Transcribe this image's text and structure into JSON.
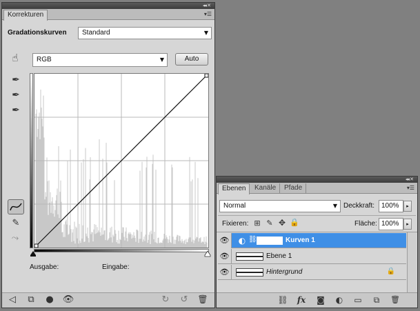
{
  "korrekturen": {
    "tab_label": "Korrekturen",
    "preset_label": "Gradationskurven",
    "preset_value": "Standard",
    "channel_value": "RGB",
    "auto_label": "Auto",
    "output_label": "Ausgabe:",
    "input_label": "Eingabe:",
    "curve_points": [
      [
        0,
        0
      ],
      [
        255,
        255
      ]
    ],
    "histogram_color": "#c8c8c8"
  },
  "ebenen": {
    "tabs": [
      {
        "label": "Ebenen"
      },
      {
        "label": "Kanäle"
      },
      {
        "label": "Pfade"
      }
    ],
    "blend_mode": "Normal",
    "opacity_label": "Deckkraft:",
    "opacity_value": "100%",
    "lock_label": "Fixieren:",
    "fill_label": "Fläche:",
    "fill_value": "100%",
    "layers": [
      {
        "name": "Kurven 1",
        "selected": true
      },
      {
        "name": "Ebene 1",
        "selected": false
      },
      {
        "name": "Hintergrund",
        "selected": false,
        "locked": true
      }
    ],
    "footer_fx_label": "fx"
  },
  "colors": {
    "panel_bg": "#d6d6d6",
    "selection": "#3f8fe6",
    "workspace": "#808080"
  }
}
